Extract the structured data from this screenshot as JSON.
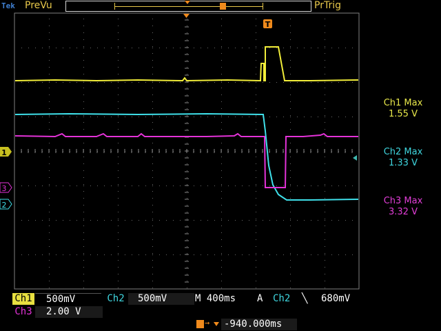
{
  "header": {
    "brand": "Tek",
    "acq_state": "PreVu",
    "trigger_status": "PrTrig"
  },
  "trigger_marker": "T",
  "markers": {
    "ch1": "1",
    "ch2": "2",
    "ch3": "3"
  },
  "measurements": [
    {
      "label": "Ch1 Max",
      "value": "1.55 V",
      "color": "#e8e84a"
    },
    {
      "label": "Ch2 Max",
      "value": "1.33 V",
      "color": "#3fd6df"
    },
    {
      "label": "Ch3 Max",
      "value": "3.32 V",
      "color": "#e23ed8"
    }
  ],
  "settings": {
    "ch1_label": "Ch1",
    "ch1_scale": "500mV",
    "ch2_label": "Ch2",
    "ch2_scale": "500mV",
    "timebase": "M 400ms",
    "trigger_mode": "A",
    "trigger_source": "Ch2",
    "trigger_slope": "⿺",
    "trigger_level": "680mV",
    "ch3_label": "Ch3",
    "ch3_scale": "2.00 V",
    "position": "-940.000ms"
  },
  "colors": {
    "ch1": "#f2ee3a",
    "ch2": "#3fe0ea",
    "ch3": "#e432d8",
    "accent": "#f08a1c"
  }
}
